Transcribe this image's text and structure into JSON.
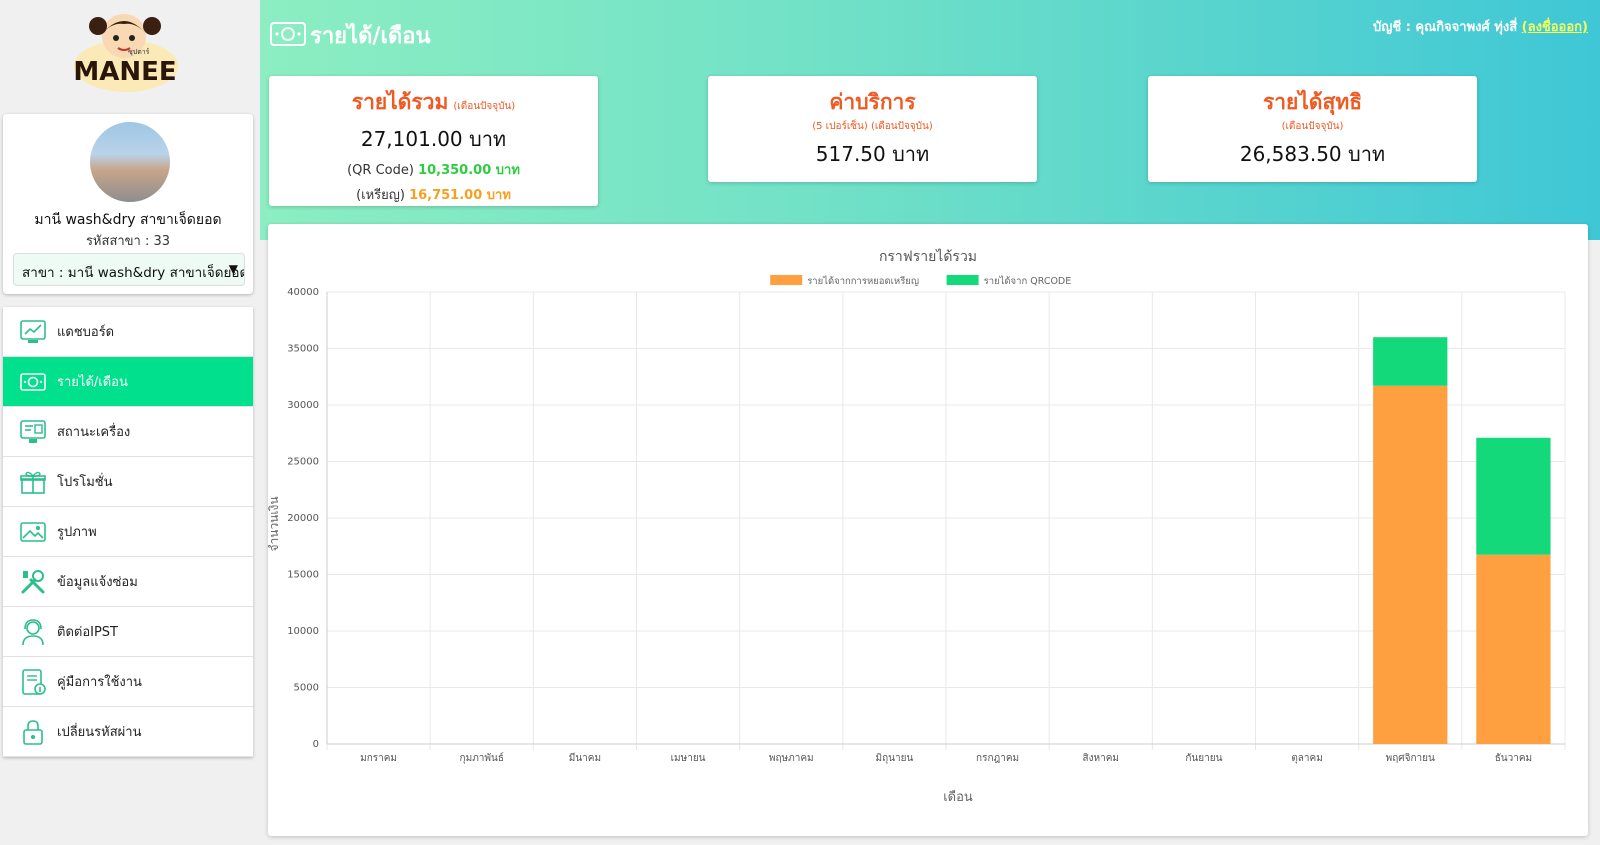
{
  "brand": {
    "logo_text": "MANEE",
    "logo_small_text": "ซุปตาร์"
  },
  "profile": {
    "shop_name": "มานี wash&dry สาขาเจ็ดยอด",
    "branch_code": "รหัสสาขา : 33",
    "branch_select_value": "สาขา : มานี wash&dry สาขาเจ็ดยอด"
  },
  "menu": [
    {
      "label": "แดชบอร์ด",
      "icon": "dashboard-icon",
      "active": false
    },
    {
      "label": "รายได้/เดือน",
      "icon": "money-icon",
      "active": true
    },
    {
      "label": "สถานะเครื่อง",
      "icon": "monitor-icon",
      "active": false
    },
    {
      "label": "โปรโมชั่น",
      "icon": "gift-icon",
      "active": false
    },
    {
      "label": "รูปภาพ",
      "icon": "image-icon",
      "active": false
    },
    {
      "label": "ข้อมูลแจ้งซ่อม",
      "icon": "tools-icon",
      "active": false
    },
    {
      "label": "ติดต่อIPST",
      "icon": "support-icon",
      "active": false
    },
    {
      "label": "คู่มือการใช้งาน",
      "icon": "manual-icon",
      "active": false
    },
    {
      "label": "เปลี่ยนรหัสผ่าน",
      "icon": "lock-icon",
      "active": false
    }
  ],
  "header": {
    "title": "รายได้/เดือน",
    "account_prefix": "บัญชี : คุณกิจจาพงศ์ ทุ่งสี่ ",
    "logout_label": "(ลงชื่อออก)"
  },
  "cards": {
    "total": {
      "title": "รายได้รวม",
      "sub": "(เดือนปัจจุบัน)",
      "value": "27,101.00 บาท",
      "qr_prefix": "(QR Code) ",
      "qr_value": "10,350.00 บาท",
      "coin_prefix": "(เหรียญ) ",
      "coin_value": "16,751.00 บาท"
    },
    "fee": {
      "title": "ค่าบริการ",
      "sub": "(5 เปอร์เซ็น) (เดือนปัจจุบัน)",
      "value": "517.50 บาท"
    },
    "net": {
      "title": "รายได้สุทธิ",
      "sub": "(เดือนปัจจุบัน)",
      "value": "26,583.50 บาท"
    }
  },
  "colors": {
    "coin": "#ffa040",
    "qr": "#14d97a",
    "accent": "#00e08d",
    "card_title": "#f05a22"
  },
  "chart_data": {
    "type": "bar",
    "stacked": true,
    "title": "กราฟรายได้รวม",
    "xlabel": "เดือน",
    "ylabel": "จำนวนเงิน",
    "ylim": [
      0,
      40000
    ],
    "yticks": [
      0,
      5000,
      10000,
      15000,
      20000,
      25000,
      30000,
      35000,
      40000
    ],
    "legend_position": "top",
    "grid": true,
    "categories": [
      "มกราคม",
      "กุมภาพันธ์",
      "มีนาคม",
      "เมษายน",
      "พฤษภาคม",
      "มิถุนายน",
      "กรกฎาคม",
      "สิงหาคม",
      "กันยายน",
      "ตุลาคม",
      "พฤศจิกายน",
      "ธันวาคม"
    ],
    "series": [
      {
        "name": "รายได้จากการหยอดเหรียญ",
        "color": "#ffa040",
        "values": [
          0,
          0,
          0,
          0,
          0,
          0,
          0,
          0,
          0,
          0,
          31700,
          16751
        ]
      },
      {
        "name": "รายได้จาก QRCODE",
        "color": "#14d97a",
        "values": [
          0,
          0,
          0,
          0,
          0,
          0,
          0,
          0,
          0,
          0,
          4300,
          10350
        ]
      }
    ]
  }
}
